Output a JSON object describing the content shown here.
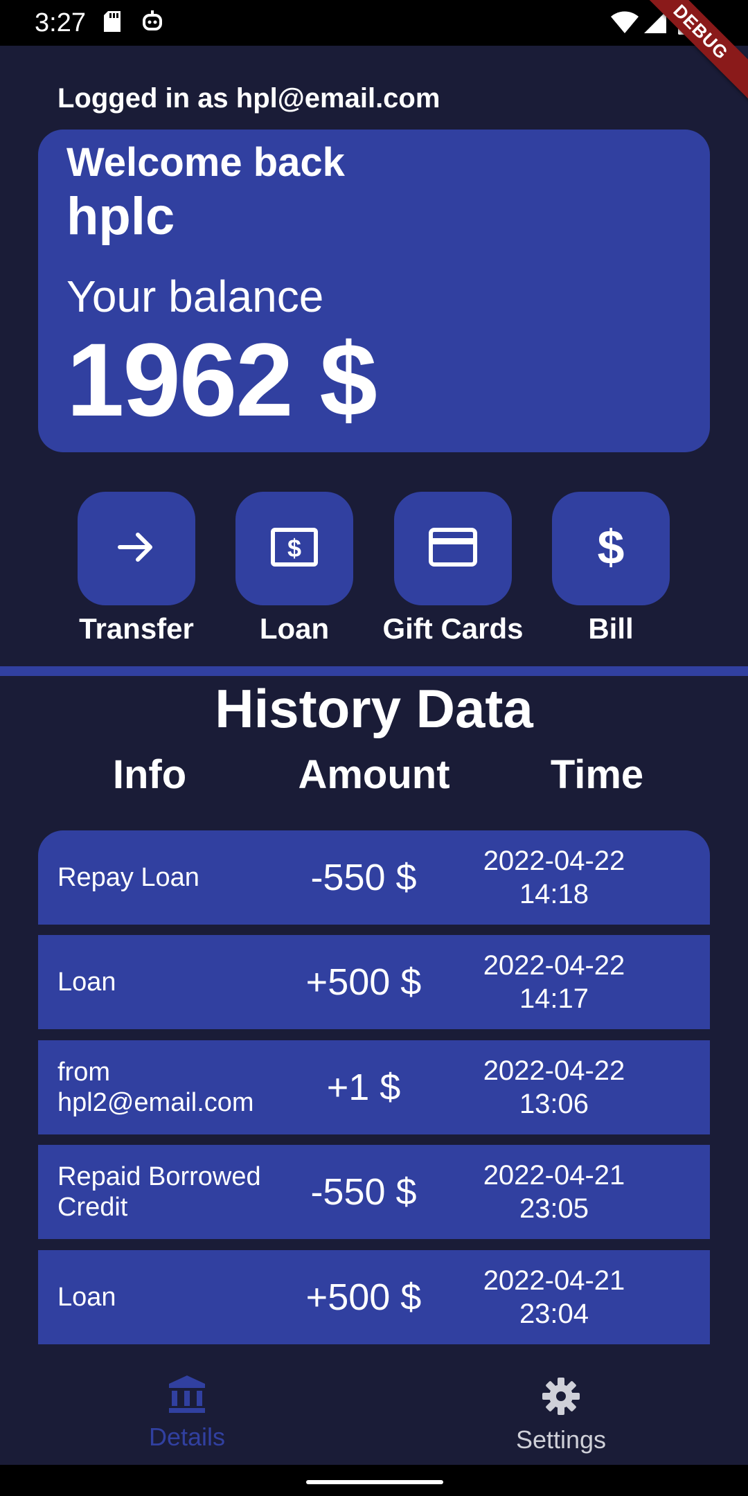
{
  "status_bar": {
    "time": "3:27",
    "debug_label": "DEBUG"
  },
  "header": {
    "logged_in": "Logged in as hpl@email.com"
  },
  "balance_card": {
    "welcome": "Welcome back",
    "username": "hplc",
    "balance_label": "Your balance",
    "balance_amount": "1962 $"
  },
  "actions": [
    {
      "label": "Transfer",
      "icon": "arrow-right-icon"
    },
    {
      "label": "Loan",
      "icon": "money-bill-icon"
    },
    {
      "label": "Gift Cards",
      "icon": "credit-card-icon"
    },
    {
      "label": "Bill",
      "icon": "dollar-icon"
    }
  ],
  "history": {
    "title": "History Data",
    "columns": {
      "info": "Info",
      "amount": "Amount",
      "time": "Time"
    },
    "rows": [
      {
        "info": "Repay Loan",
        "amount": "-550 $",
        "time": "2022-04-22\n14:18"
      },
      {
        "info": "Loan",
        "amount": "+500 $",
        "time": "2022-04-22\n14:17"
      },
      {
        "info": "from hpl2@email.com",
        "amount": "+1 $",
        "time": "2022-04-22\n13:06"
      },
      {
        "info": "Repaid Borrowed Credit",
        "amount": "-550 $",
        "time": "2022-04-21\n23:05"
      },
      {
        "info": "Loan",
        "amount": "+500 $",
        "time": "2022-04-21\n23:04"
      }
    ]
  },
  "bottom_nav": {
    "items": [
      {
        "label": "Details",
        "icon": "bank-icon",
        "active": true
      },
      {
        "label": "Settings",
        "icon": "gear-icon",
        "active": false
      }
    ]
  },
  "colors": {
    "background": "#1a1c37",
    "card": "#3140a0",
    "nav_active": "#3140a0",
    "nav_inactive": "#cfd0d8",
    "debug_ribbon": "#8a1a1a"
  }
}
